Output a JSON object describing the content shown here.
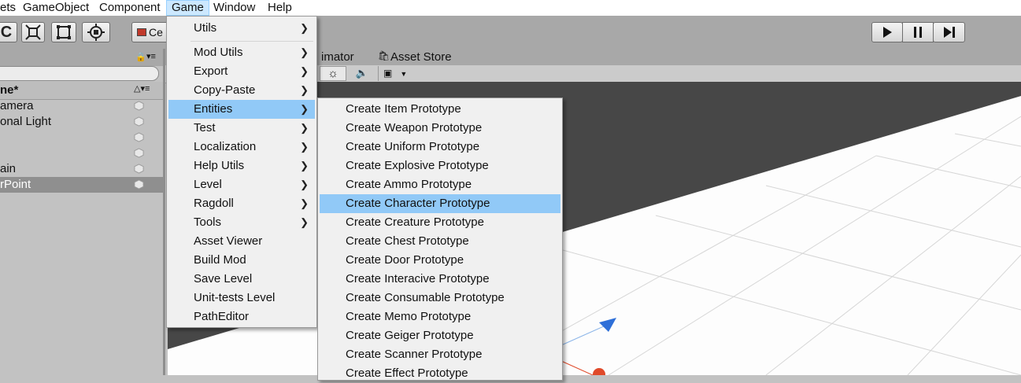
{
  "menubar": {
    "items": [
      "ets",
      "GameObject",
      "Component",
      "Game",
      "Window",
      "Help"
    ]
  },
  "toolbar": {
    "pivot_label": "Ce"
  },
  "tabs": {
    "animator": "imator",
    "asset_store": "Asset Store"
  },
  "hierarchy": {
    "title": "ne*",
    "rows": [
      "amera",
      "onal Light",
      "",
      "",
      "ain",
      "rPoint"
    ]
  },
  "game_menu": {
    "items": [
      {
        "label": "Utils",
        "submenu": true
      },
      {
        "label": "Mod Utils",
        "submenu": true
      },
      {
        "label": "Export",
        "submenu": true
      },
      {
        "label": "Copy-Paste",
        "submenu": true
      },
      {
        "label": "Entities",
        "submenu": true
      },
      {
        "label": "Test",
        "submenu": true
      },
      {
        "label": "Localization",
        "submenu": true
      },
      {
        "label": "Help Utils",
        "submenu": true
      },
      {
        "label": "Level",
        "submenu": true
      },
      {
        "label": "Ragdoll",
        "submenu": true
      },
      {
        "label": "Tools",
        "submenu": true
      },
      {
        "label": "Asset Viewer",
        "submenu": false
      },
      {
        "label": "Build Mod",
        "submenu": false
      },
      {
        "label": "Save Level",
        "submenu": false
      },
      {
        "label": "Unit-tests Level",
        "submenu": false
      },
      {
        "label": "PathEditor",
        "submenu": false
      }
    ],
    "highlighted": "Entities"
  },
  "entities_submenu": {
    "items": [
      "Create Item Prototype",
      "Create Weapon Prototype",
      "Create Uniform Prototype",
      "Create Explosive Prototype",
      "Create Ammo Prototype",
      "Create Character Prototype",
      "Create Creature Prototype",
      "Create Chest Prototype",
      "Create Door Prototype",
      "Create Interacive Prototype",
      "Create Consumable Prototype",
      "Create Memo Prototype",
      "Create Geiger Prototype",
      "Create Scanner Prototype",
      "Create Effect Prototype"
    ],
    "highlighted": "Create Character Prototype"
  },
  "colors": {
    "menu_highlight": "#91c9f7",
    "menubar_active": "#cce8ff",
    "toolbar_bg": "#a8a8a8",
    "scene_plane": "#474747"
  },
  "icons": {
    "play": "play-icon",
    "pause": "pause-icon",
    "step": "step-icon",
    "submenu": "chevron-right-icon"
  }
}
